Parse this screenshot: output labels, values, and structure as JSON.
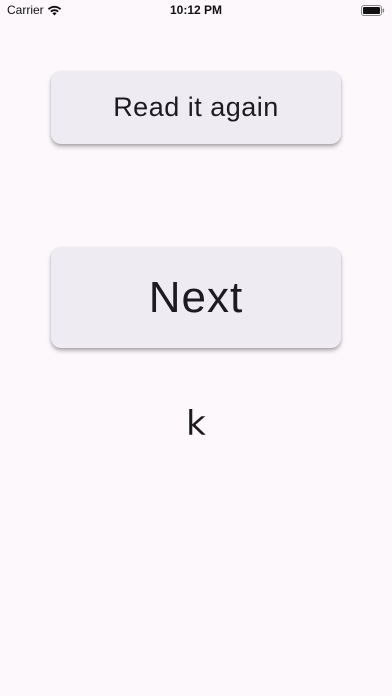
{
  "status_bar": {
    "carrier": "Carrier",
    "time": "10:12 PM",
    "wifi_icon": "wifi-icon",
    "battery_icon": "battery-icon"
  },
  "buttons": {
    "read_again_label": "Read it again",
    "next_label": "Next"
  },
  "current_letter": "k",
  "colors": {
    "background": "#fdf8fc",
    "button_bg": "#efebf2",
    "text": "#1c1b20"
  }
}
